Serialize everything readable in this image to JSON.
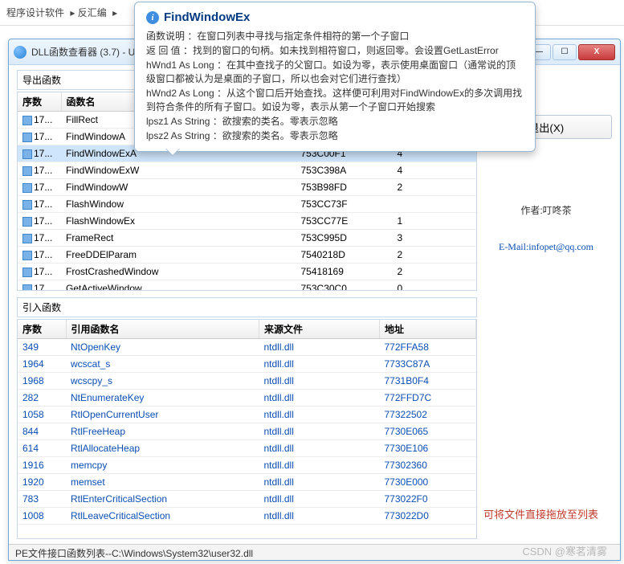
{
  "breadcrumb": [
    "程序设计软件",
    "反汇编"
  ],
  "window": {
    "title": "DLL函数查看器 (3.7) - US",
    "close_x": "X"
  },
  "tooltip": {
    "title": "FindWindowEx",
    "lines": [
      "函数说明 ：在窗口列表中寻找与指定条件相符的第一个子窗口",
      "返 回 值 ：找到的窗口的句柄。如未找到相符窗口，则返回零。会设置GetLastError",
      "hWnd1 As Long ：在其中查找子的父窗口。如设为零，表示使用桌面窗口（通常说的顶级窗口都被认为是桌面的子窗口，所以也会对它们进行查找）",
      "hWnd2 As Long ：从这个窗口后开始查找。这样便可利用对FindWindowEx的多次调用找到符合条件的所有子窗口。如设为零，表示从第一个子窗口开始搜索",
      "lpsz1 As String ：欲搜索的类名。零表示忽略",
      "lpsz2 As String ：欲搜索的类名。零表示忽略"
    ]
  },
  "export_panel": {
    "label": "导出函数",
    "headers": {
      "seq": "序数",
      "name": "函数名",
      "c3": "",
      "c4": "",
      "c5": ""
    },
    "rows": [
      {
        "seq": "17...",
        "name": "FillRect",
        "c3": "",
        "c4": "",
        "c5": "",
        "sel": false
      },
      {
        "seq": "17...",
        "name": "FindWindowA",
        "c3": "",
        "c4": "",
        "c5": "",
        "sel": false
      },
      {
        "seq": "17...",
        "name": "FindWindowExA",
        "c3": "753C00F1",
        "c4": "4",
        "c5": "",
        "sel": true
      },
      {
        "seq": "17...",
        "name": "FindWindowExW",
        "c3": "753C398A",
        "c4": "4",
        "c5": "",
        "sel": false
      },
      {
        "seq": "17...",
        "name": "FindWindowW",
        "c3": "753B98FD",
        "c4": "2",
        "c5": "",
        "sel": false
      },
      {
        "seq": "17...",
        "name": "FlashWindow",
        "c3": "753CC73F",
        "c4": "",
        "c5": "",
        "sel": false
      },
      {
        "seq": "17...",
        "name": "FlashWindowEx",
        "c3": "753CC77E",
        "c4": "1",
        "c5": "",
        "sel": false
      },
      {
        "seq": "17...",
        "name": "FrameRect",
        "c3": "753C995D",
        "c4": "3",
        "c5": "",
        "sel": false
      },
      {
        "seq": "17...",
        "name": "FreeDDElParam",
        "c3": "7540218D",
        "c4": "2",
        "c5": "",
        "sel": false
      },
      {
        "seq": "17...",
        "name": "FrostCrashedWindow",
        "c3": "75418169",
        "c4": "2",
        "c5": "",
        "sel": false
      },
      {
        "seq": "17",
        "name": "GetActiveWindow",
        "c3": "753C30C0",
        "c4": "0",
        "c5": "",
        "sel": false
      }
    ]
  },
  "import_panel": {
    "label": "引入函数",
    "headers": {
      "seq": "序数",
      "name": "引用函数名",
      "src": "来源文件",
      "addr": "地址"
    },
    "rows": [
      {
        "seq": "349",
        "name": "NtOpenKey",
        "src": "ntdll.dll",
        "addr": "772FFA58"
      },
      {
        "seq": "1964",
        "name": "wcscat_s",
        "src": "ntdll.dll",
        "addr": "7733C87A"
      },
      {
        "seq": "1968",
        "name": "wcscpy_s",
        "src": "ntdll.dll",
        "addr": "7731B0F4"
      },
      {
        "seq": "282",
        "name": "NtEnumerateKey",
        "src": "ntdll.dll",
        "addr": "772FFD7C"
      },
      {
        "seq": "1058",
        "name": "RtlOpenCurrentUser",
        "src": "ntdll.dll",
        "addr": "77322502"
      },
      {
        "seq": "844",
        "name": "RtlFreeHeap",
        "src": "ntdll.dll",
        "addr": "7730E065"
      },
      {
        "seq": "614",
        "name": "RtlAllocateHeap",
        "src": "ntdll.dll",
        "addr": "7730E106"
      },
      {
        "seq": "1916",
        "name": "memcpy",
        "src": "ntdll.dll",
        "addr": "77302360"
      },
      {
        "seq": "1920",
        "name": "memset",
        "src": "ntdll.dll",
        "addr": "7730E000"
      },
      {
        "seq": "783",
        "name": "RtlEnterCriticalSection",
        "src": "ntdll.dll",
        "addr": "773022F0"
      },
      {
        "seq": "1008",
        "name": "RtlLeaveCriticalSection",
        "src": "ntdll.dll",
        "addr": "773022D0"
      }
    ]
  },
  "side": {
    "exit_label": "退出(X)",
    "author": "作者:叮咚茶",
    "email": "E-Mail:infopet@qq.com",
    "drag_hint": "可将文件直接拖放至列表"
  },
  "status": "PE文件接口函数列表--C:\\Windows\\System32\\user32.dll",
  "watermark": "CSDN @寒茗清雾"
}
